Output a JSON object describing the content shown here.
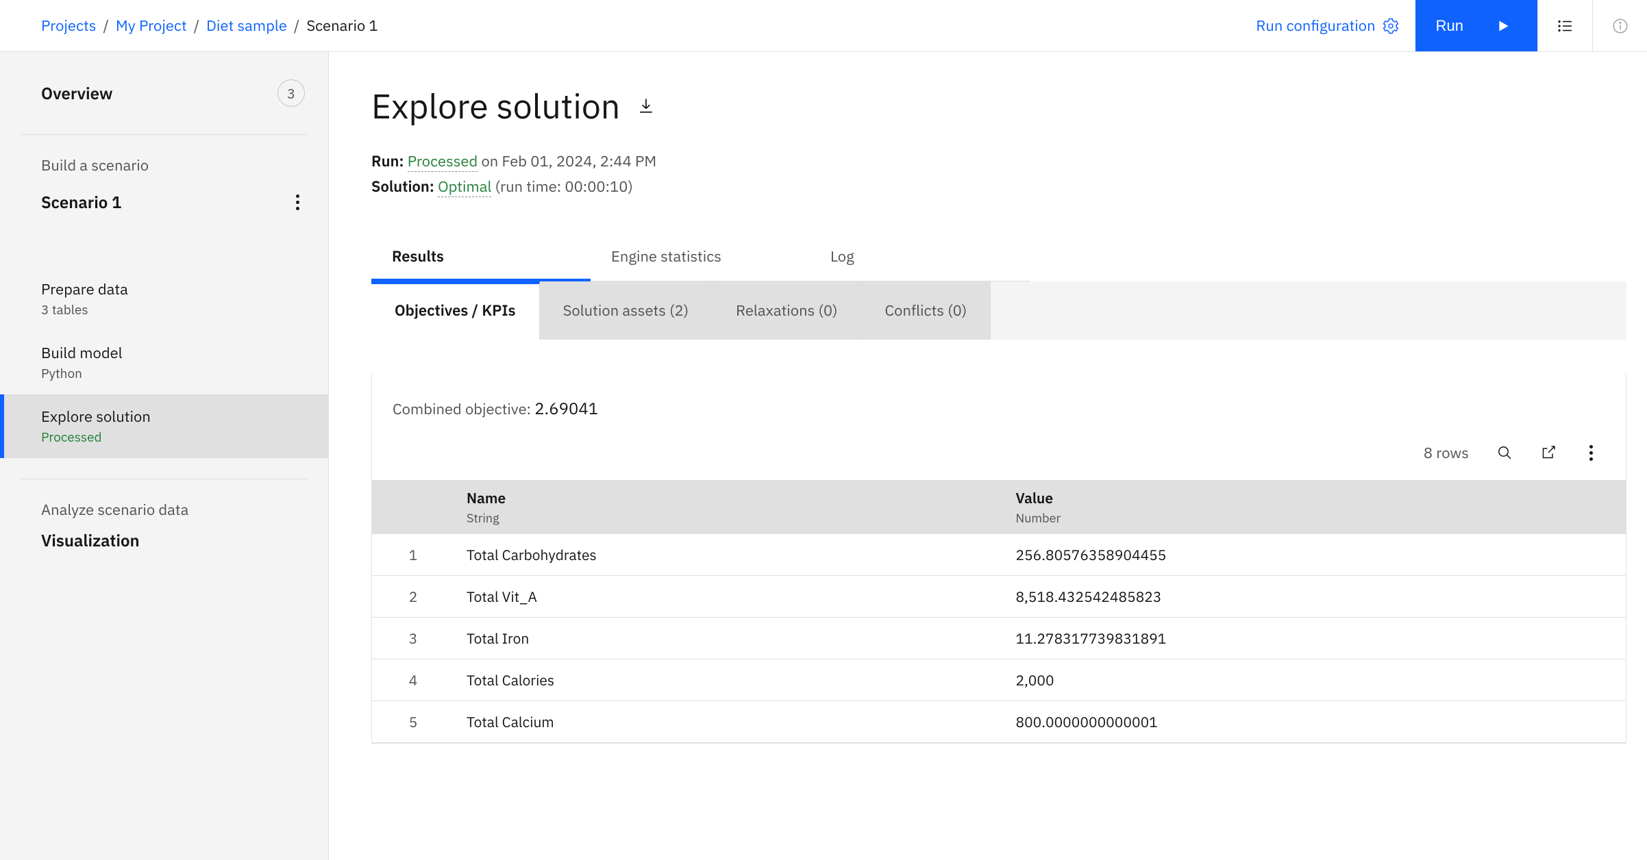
{
  "breadcrumb": {
    "items": [
      "Projects",
      "My Project",
      "Diet sample"
    ],
    "current": "Scenario 1"
  },
  "topbar": {
    "run_config": "Run configuration",
    "run": "Run"
  },
  "sidebar": {
    "overview": "Overview",
    "overview_count": "3",
    "build_label": "Build a scenario",
    "scenario": "Scenario 1",
    "nav": {
      "prepare": {
        "title": "Prepare data",
        "sub": "3 tables"
      },
      "build": {
        "title": "Build model",
        "sub": "Python"
      },
      "explore": {
        "title": "Explore solution",
        "sub": "Processed"
      }
    },
    "analyze": "Analyze scenario data",
    "viz": "Visualization"
  },
  "page": {
    "title": "Explore solution",
    "run_label": "Run:",
    "run_status": "Processed",
    "run_meta": "on Feb 01, 2024, 2:44 PM",
    "solution_label": "Solution:",
    "solution_status": "Optimal",
    "solution_meta": "(run time: 00:00:10)"
  },
  "tabs1": {
    "results": "Results",
    "engine": "Engine statistics",
    "log": "Log"
  },
  "tabs2": {
    "objectives": "Objectives / KPIs",
    "assets": "Solution assets (2)",
    "relax": "Relaxations (0)",
    "conflicts": "Conflicts (0)"
  },
  "panel": {
    "combined_label": "Combined objective:",
    "combined_value": "2.69041",
    "rows_label": "8 rows"
  },
  "table": {
    "headers": {
      "name": "Name",
      "name_type": "String",
      "value": "Value",
      "value_type": "Number"
    },
    "rows": [
      {
        "idx": "1",
        "name": "Total Carbohydrates",
        "value": "256.80576358904455"
      },
      {
        "idx": "2",
        "name": "Total Vit_A",
        "value": "8,518.432542485823"
      },
      {
        "idx": "3",
        "name": "Total Iron",
        "value": "11.278317739831891"
      },
      {
        "idx": "4",
        "name": "Total Calories",
        "value": "2,000"
      },
      {
        "idx": "5",
        "name": "Total Calcium",
        "value": "800.0000000000001"
      }
    ]
  }
}
